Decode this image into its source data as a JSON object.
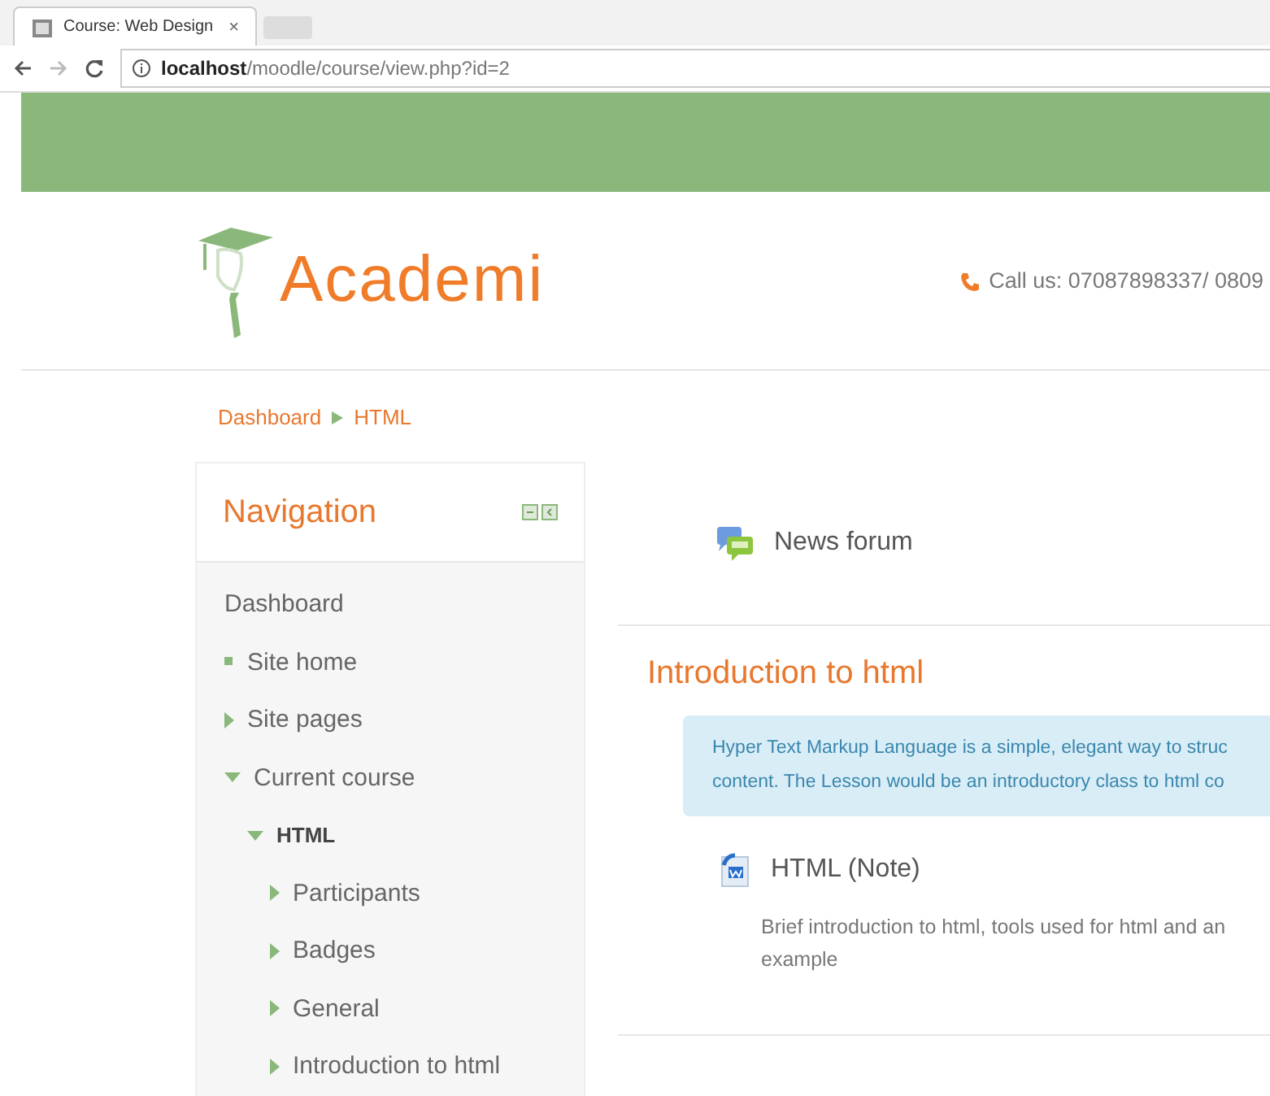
{
  "browser": {
    "tab": {
      "title": "Course: Web Design",
      "close": "×"
    },
    "url": "**localhost**/moodle/course/view.php?id=2"
  },
  "header": {
    "logo": "Academi",
    "phone": "Call us: 07087898337/ 0809"
  },
  "breadcrumb": [
    "Dashboard",
    "HTML"
  ],
  "navigation": {
    "title": "Navigation",
    "items": [
      {
        "label": "Dashboard",
        "kind": "plain",
        "active": false
      },
      {
        "label": "Site home",
        "kind": "leaf",
        "active": false
      },
      {
        "label": "Site pages",
        "kind": "branch",
        "expanded": false,
        "active": false
      },
      {
        "label": "Current course",
        "kind": "branch",
        "expanded": true,
        "active": false,
        "children": [
          {
            "label": "HTML",
            "kind": "branch",
            "expanded": true,
            "active": true,
            "children": [
              {
                "label": "Participants",
                "kind": "branch",
                "expanded": false,
                "active": false
              },
              {
                "label": "Badges",
                "kind": "branch",
                "expanded": false,
                "active": false
              },
              {
                "label": "General",
                "kind": "branch",
                "expanded": false,
                "active": false
              },
              {
                "label": "Introduction to html",
                "kind": "branch",
                "expanded": false,
                "active": false
              }
            ]
          }
        ]
      }
    ]
  },
  "course": {
    "top_activity": {
      "kind": "forum",
      "title": "News forum"
    },
    "section": {
      "title": "Introduction to html",
      "summary_lines": [
        "Hyper Text Markup Language is a simple, elegant way to struc",
        "content. The Lesson would be an introductory class to html co"
      ],
      "activities": [
        {
          "kind": "file",
          "title": "HTML (Note)",
          "description_lines": [
            "Brief introduction to html, tools used for html and an",
            "example"
          ]
        }
      ]
    }
  }
}
